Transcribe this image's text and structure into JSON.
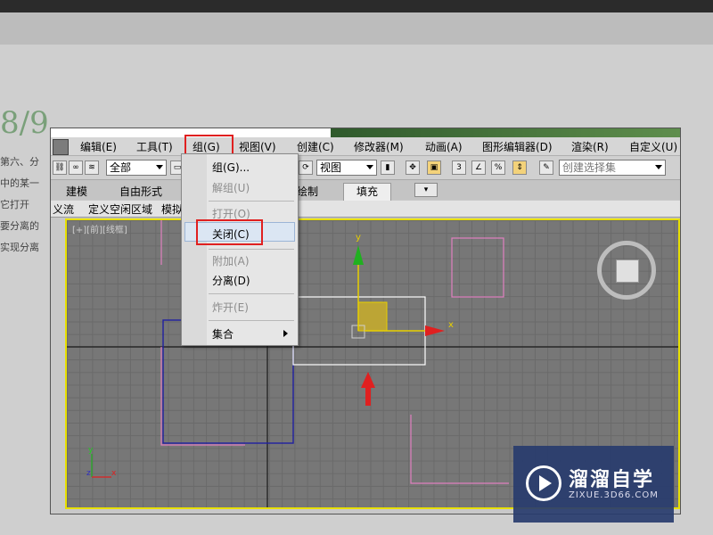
{
  "background": {
    "step_text": "8/9",
    "text_lines": [
      "第六、分",
      "中的某一",
      "它打开",
      "要分离的",
      "实现分离"
    ]
  },
  "menubar": {
    "items": [
      "编辑(E)",
      "工具(T)",
      "组(G)",
      "视图(V)",
      "创建(C)",
      "修改器(M)",
      "动画(A)",
      "图形编辑器(D)",
      "渲染(R)",
      "自定义(U)"
    ]
  },
  "toolbar": {
    "selection_filter": "全部",
    "reference_coord": "视图",
    "named_selection_placeholder": "创建选择集"
  },
  "ribbon": {
    "tabs": [
      "建模",
      "自由形式",
      "绘制",
      "填充"
    ],
    "active_tab": "填充"
  },
  "subbar": {
    "items": [
      "义流",
      "定义空闲区域",
      "模拟"
    ]
  },
  "viewport": {
    "label": "[+][前][线框]",
    "axis_y": "y",
    "axis_x": "x",
    "corner_y": "y",
    "corner_z": "z",
    "corner_x": "x"
  },
  "group_menu": {
    "items": [
      {
        "label": "组(G)...",
        "enabled": true
      },
      {
        "label": "解组(U)",
        "enabled": false
      },
      {
        "label": "打开(O)",
        "enabled": false
      },
      {
        "label": "关闭(C)",
        "enabled": true,
        "highlighted": true
      },
      {
        "label": "附加(A)",
        "enabled": false
      },
      {
        "label": "分离(D)",
        "enabled": true
      },
      {
        "label": "炸开(E)",
        "enabled": false
      },
      {
        "label": "集合",
        "enabled": true,
        "submenu": true
      }
    ]
  },
  "watermark": {
    "name": "溜溜自学",
    "url": "ZIXUE.3D66.COM"
  },
  "colors": {
    "highlight_red": "#e02020",
    "viewport_border": "#e8e000",
    "pink_shape": "#e080c0",
    "blue_shape": "#2020a0",
    "gizmo_yellow": "#e8d000",
    "gizmo_green": "#20b020",
    "gizmo_red": "#e02020"
  }
}
